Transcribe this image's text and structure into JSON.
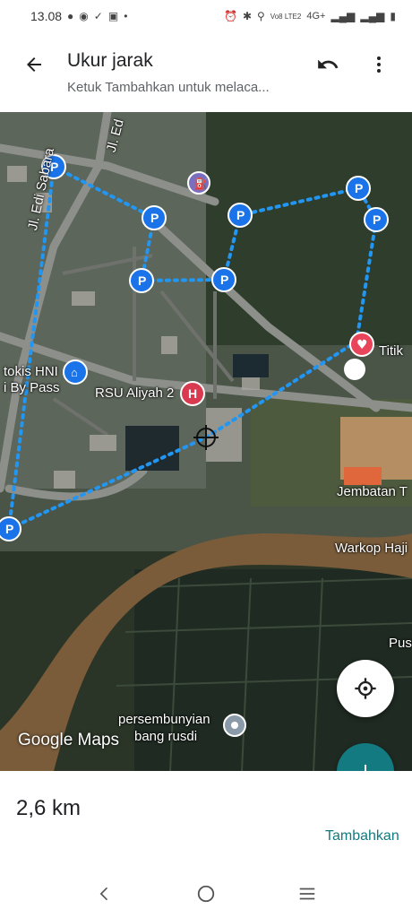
{
  "status": {
    "time": "13.08",
    "network": "4G+",
    "volte": "Vo8 LTE2"
  },
  "header": {
    "title": "Ukur jarak",
    "subtitle": "Ketuk Tambahkan untuk melaca..."
  },
  "map": {
    "labels": {
      "road1": "Jl. Ed",
      "road2": "Jl. Edi Sabara",
      "hospital": "RSU Aliyah 2",
      "store_line1": "tokis HNI",
      "store_line2": "i By Pass",
      "titik": "Titik",
      "bridge": "Jembatan T",
      "warkop": "Warkop Haji",
      "pus": "Pus",
      "hideout_line1": "persembunyian",
      "hideout_line2": "bang rusdi"
    },
    "brand": "Google Maps"
  },
  "bottom": {
    "distance": "2,6 km",
    "add_label": "Tambahkan"
  }
}
